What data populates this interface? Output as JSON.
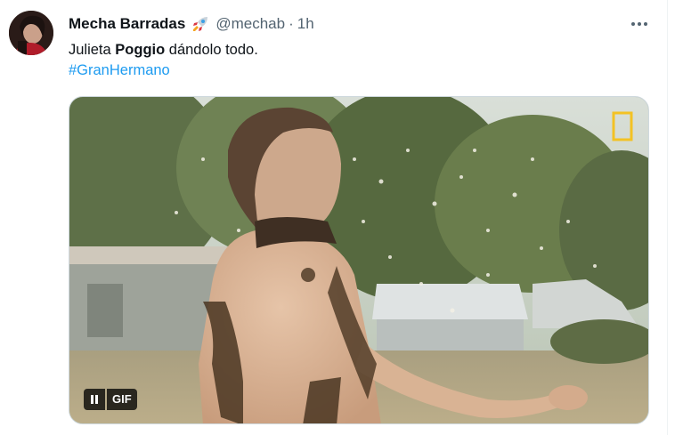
{
  "author": {
    "display_name": "Mecha Barradas",
    "emoji": "rocket-emoji",
    "handle": "@mechab",
    "separator": "·",
    "time": "1h"
  },
  "tweet": {
    "text_before": "Julieta ",
    "text_bold": "Poggio",
    "text_after": " dándolo todo.",
    "hashtag": "#GranHermano"
  },
  "media": {
    "badge": "GIF",
    "pause_icon": "pause-icon",
    "watermark_icon": "yellow-frame-logo"
  },
  "colors": {
    "text": "#0f1419",
    "secondary": "#536471",
    "link": "#1d9bf0",
    "border": "#cfd9de"
  }
}
